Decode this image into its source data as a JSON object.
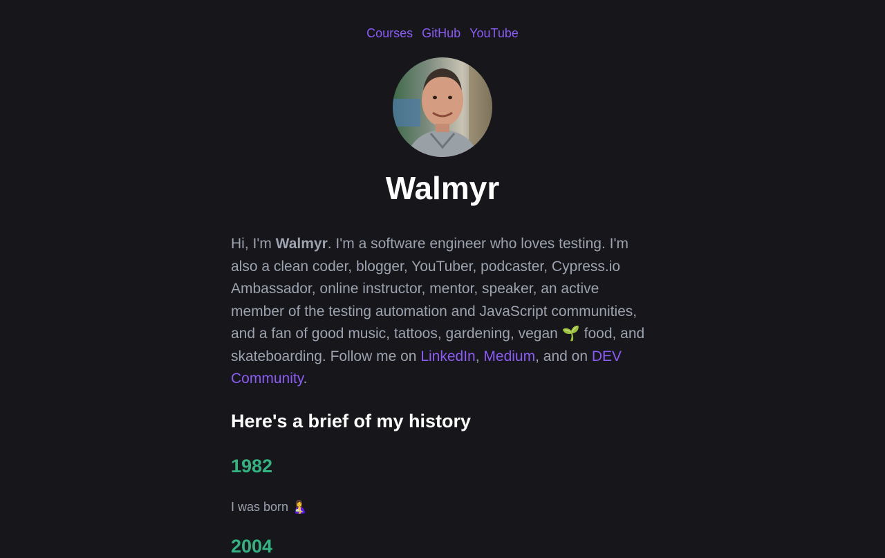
{
  "nav": {
    "links": [
      "Courses",
      "GitHub",
      "YouTube"
    ]
  },
  "profile": {
    "name": "Walmyr"
  },
  "intro": {
    "greeting": "Hi, I'm ",
    "name_bold": "Walmyr",
    "description": ". I'm a software engineer who loves testing. I'm also a clean coder, blogger, YouTuber, podcaster, Cypress.io Ambassador, online instructor, mentor, speaker, an active member of the testing automation and JavaScript communities, and a fan of good music, tattoos, gardening, vegan 🌱 food, and skateboarding. Follow me on ",
    "link_linkedin": "LinkedIn",
    "sep1": ", ",
    "link_medium": "Medium",
    "sep2": ", and on ",
    "link_dev": "DEV Community",
    "end": "."
  },
  "history": {
    "heading": "Here's a brief of my history",
    "entries": [
      {
        "year": "1982",
        "text": "I was born 🤱"
      },
      {
        "year": "2004",
        "text": ""
      }
    ]
  },
  "colors": {
    "background": "#16161b",
    "link": "#8b5cf6",
    "year": "#34b382",
    "body_text": "#9ca3af",
    "heading": "#ffffff"
  }
}
